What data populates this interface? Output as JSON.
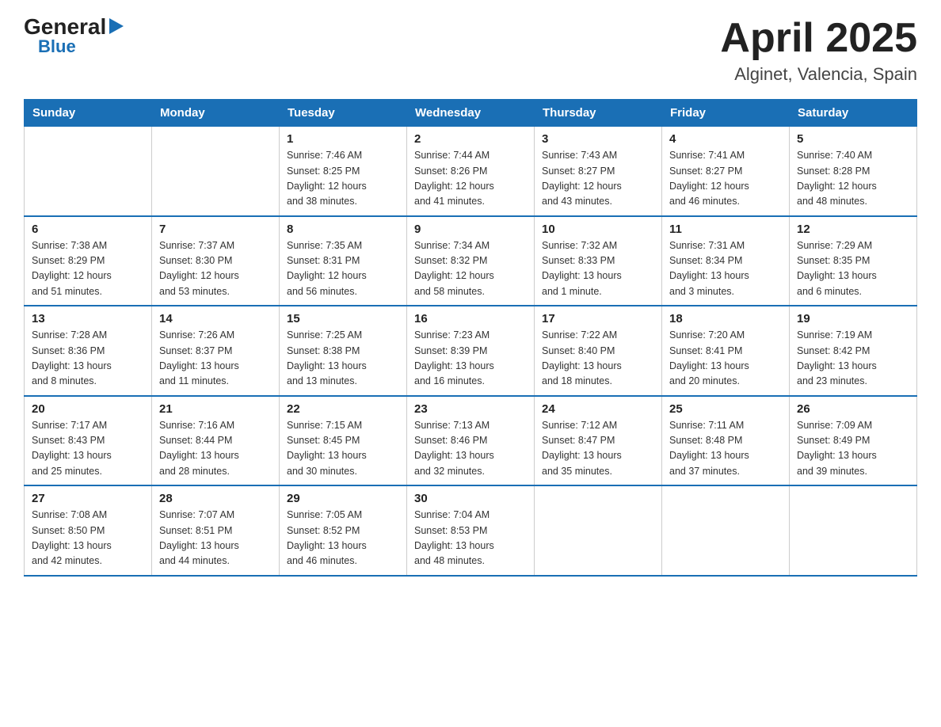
{
  "header": {
    "logo_general": "General",
    "logo_blue": "Blue",
    "title": "April 2025",
    "location": "Alginet, Valencia, Spain"
  },
  "weekdays": [
    "Sunday",
    "Monday",
    "Tuesday",
    "Wednesday",
    "Thursday",
    "Friday",
    "Saturday"
  ],
  "weeks": [
    [
      {
        "day": "",
        "info": ""
      },
      {
        "day": "",
        "info": ""
      },
      {
        "day": "1",
        "info": "Sunrise: 7:46 AM\nSunset: 8:25 PM\nDaylight: 12 hours\nand 38 minutes."
      },
      {
        "day": "2",
        "info": "Sunrise: 7:44 AM\nSunset: 8:26 PM\nDaylight: 12 hours\nand 41 minutes."
      },
      {
        "day": "3",
        "info": "Sunrise: 7:43 AM\nSunset: 8:27 PM\nDaylight: 12 hours\nand 43 minutes."
      },
      {
        "day": "4",
        "info": "Sunrise: 7:41 AM\nSunset: 8:27 PM\nDaylight: 12 hours\nand 46 minutes."
      },
      {
        "day": "5",
        "info": "Sunrise: 7:40 AM\nSunset: 8:28 PM\nDaylight: 12 hours\nand 48 minutes."
      }
    ],
    [
      {
        "day": "6",
        "info": "Sunrise: 7:38 AM\nSunset: 8:29 PM\nDaylight: 12 hours\nand 51 minutes."
      },
      {
        "day": "7",
        "info": "Sunrise: 7:37 AM\nSunset: 8:30 PM\nDaylight: 12 hours\nand 53 minutes."
      },
      {
        "day": "8",
        "info": "Sunrise: 7:35 AM\nSunset: 8:31 PM\nDaylight: 12 hours\nand 56 minutes."
      },
      {
        "day": "9",
        "info": "Sunrise: 7:34 AM\nSunset: 8:32 PM\nDaylight: 12 hours\nand 58 minutes."
      },
      {
        "day": "10",
        "info": "Sunrise: 7:32 AM\nSunset: 8:33 PM\nDaylight: 13 hours\nand 1 minute."
      },
      {
        "day": "11",
        "info": "Sunrise: 7:31 AM\nSunset: 8:34 PM\nDaylight: 13 hours\nand 3 minutes."
      },
      {
        "day": "12",
        "info": "Sunrise: 7:29 AM\nSunset: 8:35 PM\nDaylight: 13 hours\nand 6 minutes."
      }
    ],
    [
      {
        "day": "13",
        "info": "Sunrise: 7:28 AM\nSunset: 8:36 PM\nDaylight: 13 hours\nand 8 minutes."
      },
      {
        "day": "14",
        "info": "Sunrise: 7:26 AM\nSunset: 8:37 PM\nDaylight: 13 hours\nand 11 minutes."
      },
      {
        "day": "15",
        "info": "Sunrise: 7:25 AM\nSunset: 8:38 PM\nDaylight: 13 hours\nand 13 minutes."
      },
      {
        "day": "16",
        "info": "Sunrise: 7:23 AM\nSunset: 8:39 PM\nDaylight: 13 hours\nand 16 minutes."
      },
      {
        "day": "17",
        "info": "Sunrise: 7:22 AM\nSunset: 8:40 PM\nDaylight: 13 hours\nand 18 minutes."
      },
      {
        "day": "18",
        "info": "Sunrise: 7:20 AM\nSunset: 8:41 PM\nDaylight: 13 hours\nand 20 minutes."
      },
      {
        "day": "19",
        "info": "Sunrise: 7:19 AM\nSunset: 8:42 PM\nDaylight: 13 hours\nand 23 minutes."
      }
    ],
    [
      {
        "day": "20",
        "info": "Sunrise: 7:17 AM\nSunset: 8:43 PM\nDaylight: 13 hours\nand 25 minutes."
      },
      {
        "day": "21",
        "info": "Sunrise: 7:16 AM\nSunset: 8:44 PM\nDaylight: 13 hours\nand 28 minutes."
      },
      {
        "day": "22",
        "info": "Sunrise: 7:15 AM\nSunset: 8:45 PM\nDaylight: 13 hours\nand 30 minutes."
      },
      {
        "day": "23",
        "info": "Sunrise: 7:13 AM\nSunset: 8:46 PM\nDaylight: 13 hours\nand 32 minutes."
      },
      {
        "day": "24",
        "info": "Sunrise: 7:12 AM\nSunset: 8:47 PM\nDaylight: 13 hours\nand 35 minutes."
      },
      {
        "day": "25",
        "info": "Sunrise: 7:11 AM\nSunset: 8:48 PM\nDaylight: 13 hours\nand 37 minutes."
      },
      {
        "day": "26",
        "info": "Sunrise: 7:09 AM\nSunset: 8:49 PM\nDaylight: 13 hours\nand 39 minutes."
      }
    ],
    [
      {
        "day": "27",
        "info": "Sunrise: 7:08 AM\nSunset: 8:50 PM\nDaylight: 13 hours\nand 42 minutes."
      },
      {
        "day": "28",
        "info": "Sunrise: 7:07 AM\nSunset: 8:51 PM\nDaylight: 13 hours\nand 44 minutes."
      },
      {
        "day": "29",
        "info": "Sunrise: 7:05 AM\nSunset: 8:52 PM\nDaylight: 13 hours\nand 46 minutes."
      },
      {
        "day": "30",
        "info": "Sunrise: 7:04 AM\nSunset: 8:53 PM\nDaylight: 13 hours\nand 48 minutes."
      },
      {
        "day": "",
        "info": ""
      },
      {
        "day": "",
        "info": ""
      },
      {
        "day": "",
        "info": ""
      }
    ]
  ]
}
